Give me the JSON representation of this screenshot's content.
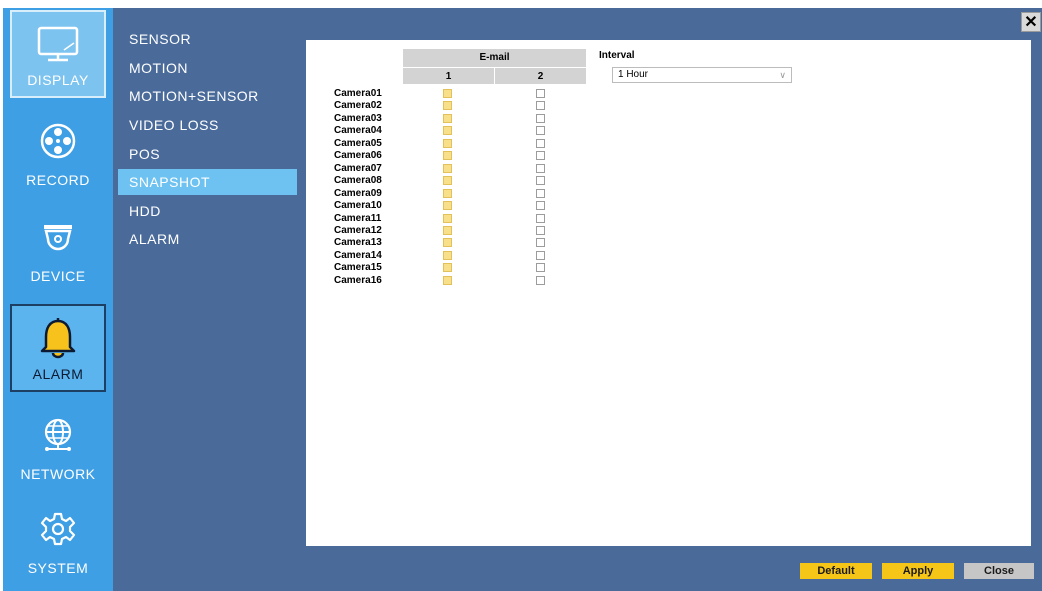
{
  "nav": {
    "items": [
      {
        "label": "DISPLAY",
        "icon": "monitor-icon"
      },
      {
        "label": "RECORD",
        "icon": "film-reel-icon"
      },
      {
        "label": "DEVICE",
        "icon": "dome-camera-icon"
      },
      {
        "label": "ALARM",
        "icon": "bell-icon"
      },
      {
        "label": "NETWORK",
        "icon": "globe-icon"
      },
      {
        "label": "SYSTEM",
        "icon": "gear-icon"
      }
    ],
    "active": "ALARM"
  },
  "submenu": {
    "items": [
      "SENSOR",
      "MOTION",
      "MOTION+SENSOR",
      "VIDEO LOSS",
      "POS",
      "SNAPSHOT",
      "HDD",
      "ALARM"
    ],
    "active": "SNAPSHOT"
  },
  "email_table": {
    "group_header": "E-mail",
    "columns": [
      "1",
      "2"
    ],
    "cameras": [
      "Camera01",
      "Camera02",
      "Camera03",
      "Camera04",
      "Camera05",
      "Camera06",
      "Camera07",
      "Camera08",
      "Camera09",
      "Camera10",
      "Camera11",
      "Camera12",
      "Camera13",
      "Camera14",
      "Camera15",
      "Camera16"
    ],
    "column1_checked": [
      true,
      true,
      true,
      true,
      true,
      true,
      true,
      true,
      true,
      true,
      true,
      true,
      true,
      true,
      true,
      true
    ],
    "column2_checked": [
      false,
      false,
      false,
      false,
      false,
      false,
      false,
      false,
      false,
      false,
      false,
      false,
      false,
      false,
      false,
      false
    ]
  },
  "interval": {
    "label": "Interval",
    "value": "1 Hour"
  },
  "buttons": {
    "default": "Default",
    "apply": "Apply",
    "close": "Close"
  },
  "colors": {
    "rail": "#3f9fe4",
    "panel_bg": "#4a6b9a",
    "active_submenu": "#6ec2f2",
    "checked": "#f8e08a",
    "button_yellow": "#f5c518",
    "button_gray": "#c6c6c6"
  }
}
